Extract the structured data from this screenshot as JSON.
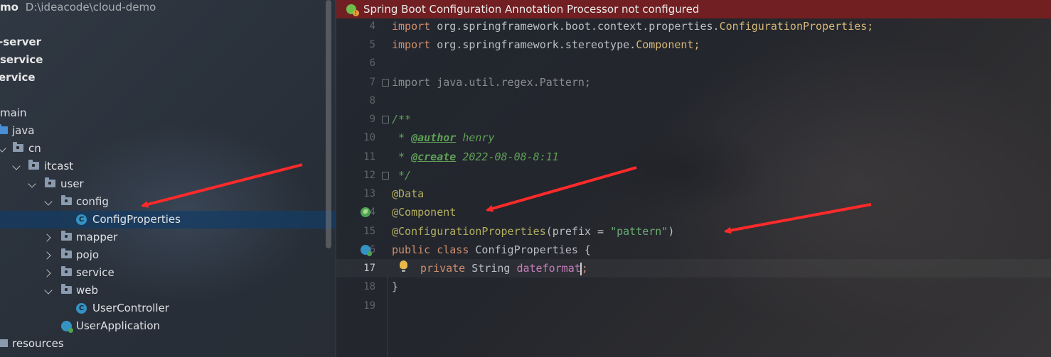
{
  "project": {
    "name": "mo",
    "path": "D:\\ideacode\\cloud-demo",
    "modules": [
      "-server",
      "service",
      "ervice"
    ],
    "tree": [
      {
        "label": "main"
      },
      {
        "label": "java"
      },
      {
        "label": "cn"
      },
      {
        "label": "itcast"
      },
      {
        "label": "user"
      },
      {
        "label": "config"
      },
      {
        "label": "ConfigProperties"
      },
      {
        "label": "mapper"
      },
      {
        "label": "pojo"
      },
      {
        "label": "service"
      },
      {
        "label": "web"
      },
      {
        "label": "UserController"
      },
      {
        "label": "UserApplication"
      },
      {
        "label": "resources"
      }
    ],
    "class_icon_letter": "C"
  },
  "editor": {
    "banner": "Spring Boot Configuration Annotation Processor not configured",
    "line_numbers": [
      "4",
      "5",
      "6",
      "7",
      "8",
      "9",
      "10",
      "11",
      "12",
      "13",
      "14",
      "15",
      "16",
      "17",
      "18",
      "19"
    ],
    "code": {
      "l4_import": "import ",
      "l4_pkg": "org.springframework.boot.context.properties.",
      "l4_cls": "ConfigurationProperties;",
      "l5_import": "import ",
      "l5_pkg": "org.springframework.stereotype.",
      "l5_cls": "Component;",
      "l7": "import java.util.regex.Pattern;",
      "l9": "/**",
      "l10_pre": " * ",
      "l10_tag": "@author",
      "l10_val": " henry",
      "l11_pre": " * ",
      "l11_tag": "@create",
      "l11_val": " 2022-08-08-8:11",
      "l12": " */",
      "l13": "@Data",
      "l14": "@Component",
      "l15_ann": "@ConfigurationProperties",
      "l15_open": "(prefix = ",
      "l15_str": "\"pattern\"",
      "l15_close": ")",
      "l16_kw": "public class ",
      "l16_name": "ConfigProperties {",
      "l17_kw": "private ",
      "l17_type": "String ",
      "l17_field": "dateformat",
      "l17_semi": ";",
      "l18": "}"
    }
  },
  "colors": {
    "banner_bg": "#7a1e22",
    "selection": "#143c64",
    "arrow": "#ff2a2a"
  }
}
